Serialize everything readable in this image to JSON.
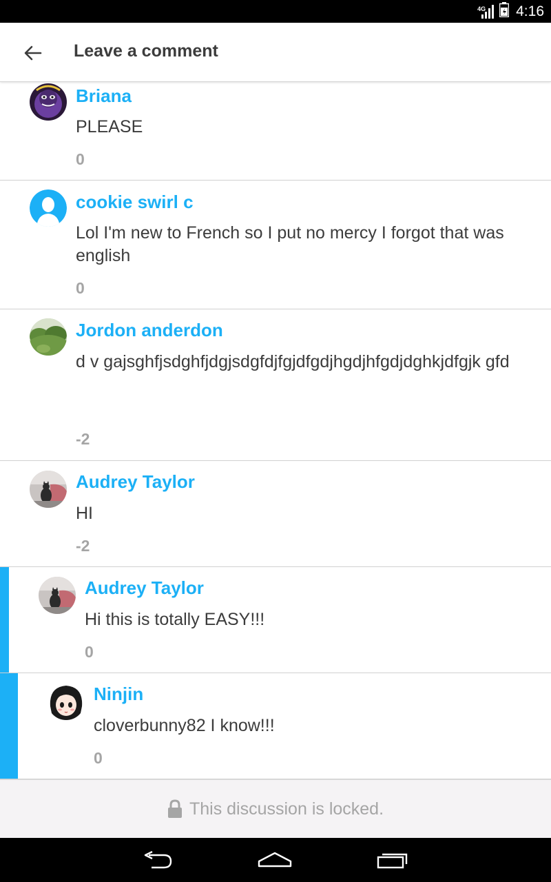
{
  "status_bar": {
    "time": "4:16",
    "network": "4G",
    "icons": [
      "signal-icon",
      "battery-icon"
    ]
  },
  "app_bar": {
    "title": "Leave a comment",
    "back_icon": "arrow-left-icon"
  },
  "comments": [
    {
      "author": "Briana",
      "text": "PLEASE",
      "votes": "0",
      "avatar": "purple-character-avatar",
      "reply_depth": 0
    },
    {
      "author": "cookie swirl c",
      "text": "Lol I'm new to French so I put no mercy I forgot that was english",
      "votes": "0",
      "avatar": "default-person-avatar",
      "reply_depth": 0
    },
    {
      "author": "Jordon anderdon",
      "text": "d v gajsghfjsdghfjdgjsdgfdjfgjdfgdjhgdjhfgdjdghkjdfgjk gfd",
      "votes": "-2",
      "avatar": "green-landscape-avatar",
      "reply_depth": 0
    },
    {
      "author": "Audrey Taylor",
      "text": "HI",
      "votes": "-2",
      "avatar": "cat-photo-avatar",
      "reply_depth": 0
    },
    {
      "author": "Audrey Taylor",
      "text": "Hi this is totally EASY!!!",
      "votes": "0",
      "avatar": "cat-photo-avatar",
      "reply_depth": 1
    },
    {
      "author": "Ninjin",
      "text": "cloverbunny82 I know!!!",
      "votes": "0",
      "avatar": "anime-girl-avatar",
      "reply_depth": 2
    }
  ],
  "locked": {
    "text": "This discussion is locked.",
    "icon": "lock-icon"
  },
  "nav_bar": {
    "icons": [
      "back-nav-icon",
      "home-nav-icon",
      "recents-nav-icon"
    ]
  },
  "colors": {
    "accent": "#1cb0f6",
    "text": "#3c3c3c",
    "muted": "#a5a5a5",
    "locked_bg": "#f5f3f5"
  }
}
